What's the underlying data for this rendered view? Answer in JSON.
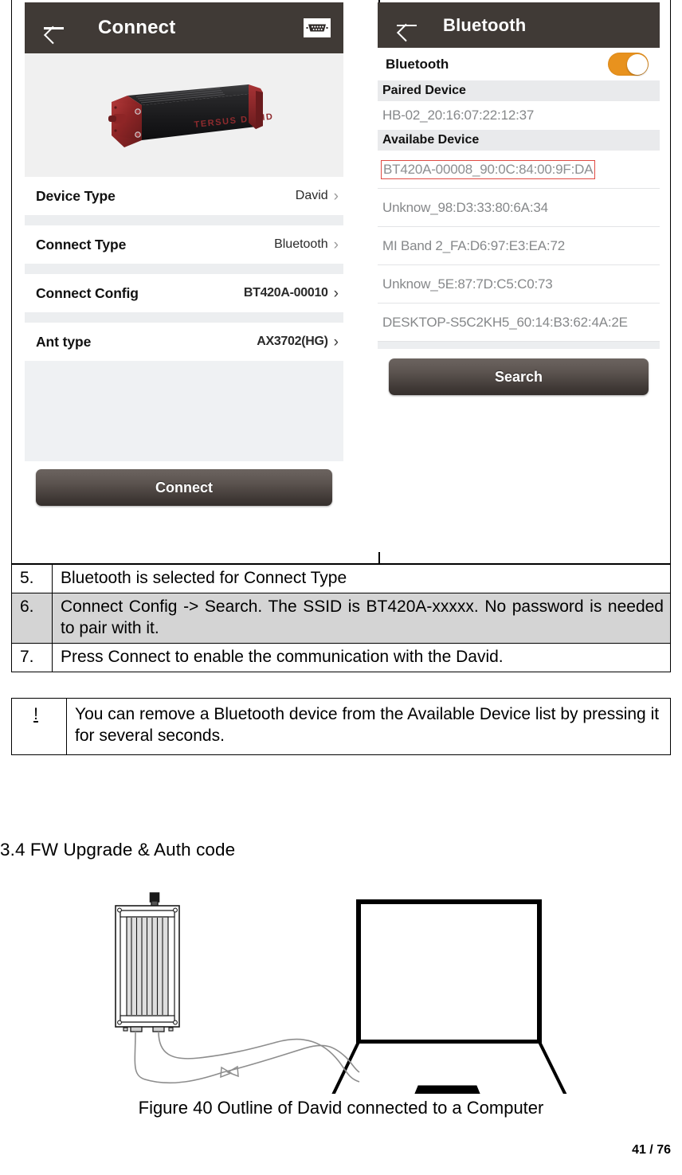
{
  "screenshots": {
    "connect_panel": {
      "appbar": {
        "title": "Connect",
        "back_icon": "back-arrow-icon",
        "right_icon": "db9-serial-port-icon"
      },
      "hero_image_alt": "Tersus David GNSS receiver",
      "rows": [
        {
          "label": "Device Type",
          "value": "David",
          "chevron": "›"
        },
        {
          "label": "Connect Type",
          "value": "Bluetooth",
          "chevron": "›"
        },
        {
          "label": "Connect Config",
          "value": "BT420A-00010",
          "chevron": "›"
        },
        {
          "label": "Ant type",
          "value": "AX3702(HG)",
          "chevron": "›"
        }
      ],
      "primary_button": "Connect"
    },
    "bluetooth_panel": {
      "appbar": {
        "title": "Bluetooth",
        "back_icon": "back-arrow-icon"
      },
      "toggle": {
        "label": "Bluetooth",
        "state": "on",
        "color": "#e8921e"
      },
      "paired_header": "Paired Device",
      "paired_devices": [
        "HB-02_20:16:07:22:12:37"
      ],
      "available_header": "Availabe Device",
      "available_devices": [
        {
          "name": "BT420A-00008_90:0C:84:00:9F:DA",
          "highlighted": true,
          "highlight_color": "#e04a43"
        },
        {
          "name": "Unknow_98:D3:33:80:6A:34",
          "highlighted": false
        },
        {
          "name": "MI Band 2_FA:D6:97:E3:EA:72",
          "highlighted": false
        },
        {
          "name": "Unknow_5E:87:7D:C5:C0:73",
          "highlighted": false
        },
        {
          "name": "DESKTOP-S5C2KH5_60:14:B3:62:4A:2E",
          "highlighted": false
        }
      ],
      "primary_button": "Search"
    }
  },
  "steps": [
    {
      "num": "5.",
      "text": "Bluetooth is selected for Connect Type",
      "shaded": false
    },
    {
      "num": "6.",
      "text": "Connect Config -> Search. The SSID is BT420A-xxxxx. No password is needed to pair with it.",
      "shaded": true
    },
    {
      "num": "7.",
      "text": "Press Connect to enable the communication with the David.",
      "shaded": false
    }
  ],
  "note": {
    "marker": "!",
    "text": "You can remove a Bluetooth device from the Available Device list by pressing it for several seconds."
  },
  "section": {
    "heading": "3.4 FW Upgrade & Auth code"
  },
  "figure": {
    "caption": "Figure 40 Outline of David connected to a Computer",
    "alt": "Outline drawing of a David receiver cabled to a laptop computer"
  },
  "footer": {
    "page": "41 / 76"
  }
}
